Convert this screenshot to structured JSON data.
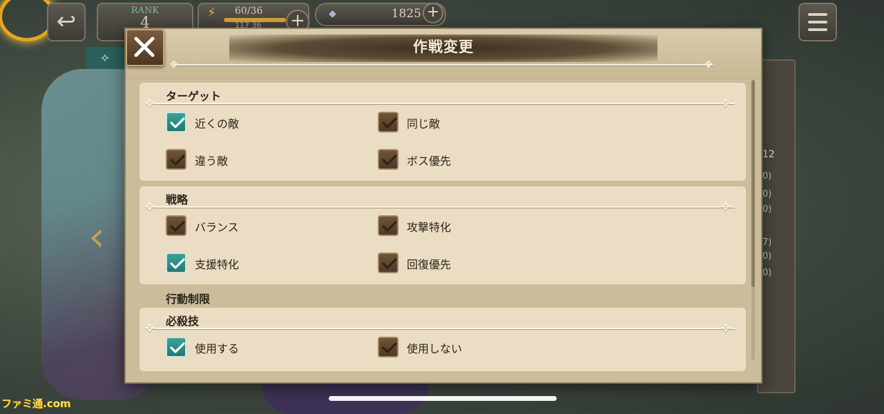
{
  "hud": {
    "rank_label": "RANK",
    "rank_value": "4",
    "stamina_text": "60/36",
    "stamina_sub": "117 36",
    "stamina_fill": 1.0,
    "gems": "1825"
  },
  "dialog": {
    "title": "作戦変更",
    "sections": {
      "target": {
        "label": "ターゲット",
        "options": [
          {
            "label": "近くの敵",
            "checked": true
          },
          {
            "label": "同じ敵",
            "checked": false
          },
          {
            "label": "違う敵",
            "checked": false
          },
          {
            "label": "ボス優先",
            "checked": false
          }
        ]
      },
      "strategy": {
        "label": "戦略",
        "options": [
          {
            "label": "バランス",
            "checked": false
          },
          {
            "label": "攻撃特化",
            "checked": false
          },
          {
            "label": "支援特化",
            "checked": true
          },
          {
            "label": "回復優先",
            "checked": false
          }
        ]
      },
      "action_limit_heading": "行動制限",
      "special": {
        "label": "必殺技",
        "options": [
          {
            "label": "使用する",
            "checked": true
          },
          {
            "label": "使用しない",
            "checked": false
          }
        ]
      }
    }
  },
  "side_panel": {
    "number": "12",
    "values": [
      "0)",
      "0)",
      "0)",
      "7)",
      "0)",
      "0)"
    ]
  },
  "watermark": "ファミ通.com",
  "colors": {
    "checked": "#2a8f86",
    "unchecked": "#5e4630",
    "panel": "#eaddc3"
  }
}
